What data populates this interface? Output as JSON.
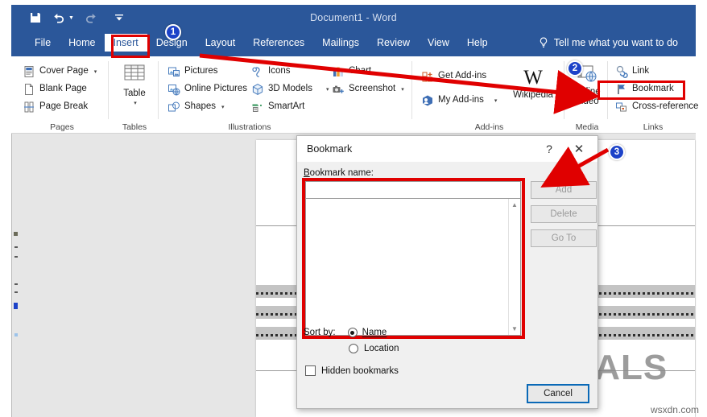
{
  "window": {
    "title": "Document1  -  Word",
    "quick_access": [
      {
        "name": "save-icon",
        "label": "Save"
      },
      {
        "name": "undo-icon",
        "label": "Undo"
      },
      {
        "name": "redo-icon",
        "label": "Redo"
      },
      {
        "name": "customize-quick-access-icon",
        "label": "Customize Quick Access Toolbar"
      }
    ]
  },
  "tabs": [
    {
      "label": "File",
      "active": false
    },
    {
      "label": "Home",
      "active": false
    },
    {
      "label": "Insert",
      "active": true
    },
    {
      "label": "Design",
      "active": false
    },
    {
      "label": "Layout",
      "active": false
    },
    {
      "label": "References",
      "active": false
    },
    {
      "label": "Mailings",
      "active": false
    },
    {
      "label": "Review",
      "active": false
    },
    {
      "label": "View",
      "active": false
    },
    {
      "label": "Help",
      "active": false
    }
  ],
  "tell_me": {
    "label": "Tell me what you want to do",
    "icon": "lightbulb-icon"
  },
  "ribbon": {
    "groups": [
      {
        "name": "Pages",
        "items": [
          {
            "label": "Cover Page",
            "icon": "cover-page-icon",
            "dropdown": true
          },
          {
            "label": "Blank Page",
            "icon": "blank-page-icon",
            "dropdown": false
          },
          {
            "label": "Page Break",
            "icon": "page-break-icon",
            "dropdown": false
          }
        ]
      },
      {
        "name": "Tables",
        "items": [
          {
            "label": "Table",
            "icon": "table-icon",
            "dropdown": true
          }
        ]
      },
      {
        "name": "Illustrations",
        "items": [
          {
            "label": "Pictures",
            "icon": "pictures-icon",
            "dropdown": false
          },
          {
            "label": "Online Pictures",
            "icon": "online-pictures-icon",
            "dropdown": false
          },
          {
            "label": "Shapes",
            "icon": "shapes-icon",
            "dropdown": true
          },
          {
            "label": "Icons",
            "icon": "icons-icon",
            "dropdown": false
          },
          {
            "label": "3D Models",
            "icon": "3d-models-icon",
            "dropdown": true
          },
          {
            "label": "SmartArt",
            "icon": "smartart-icon",
            "dropdown": false
          },
          {
            "label": "Chart",
            "icon": "chart-icon",
            "dropdown": false
          },
          {
            "label": "Screenshot",
            "icon": "screenshot-icon",
            "dropdown": true
          }
        ]
      },
      {
        "name": "Add-ins",
        "items": [
          {
            "label": "Get Add-ins",
            "icon": "get-add-ins-icon",
            "dropdown": false
          },
          {
            "label": "My Add-ins",
            "icon": "my-add-ins-icon",
            "dropdown": true
          },
          {
            "label": "Wikipedia",
            "icon": "wikipedia-icon",
            "dropdown": false
          }
        ]
      },
      {
        "name": "Media",
        "items": [
          {
            "label": "Online Video",
            "icon": "online-video-icon",
            "dropdown": false
          }
        ]
      },
      {
        "name": "Links",
        "items": [
          {
            "label": "Link",
            "icon": "link-icon",
            "dropdown": false
          },
          {
            "label": "Bookmark",
            "icon": "bookmark-icon",
            "dropdown": false
          },
          {
            "label": "Cross-reference",
            "icon": "cross-reference-icon",
            "dropdown": false
          }
        ]
      }
    ]
  },
  "dialog": {
    "title": "Bookmark",
    "help_icon": "?",
    "close_icon": "✕",
    "name_label": "Bookmark name:",
    "name_value": "",
    "list_items": [],
    "buttons": [
      {
        "label": "Add",
        "enabled": false
      },
      {
        "label": "Delete",
        "enabled": false
      },
      {
        "label": "Go To",
        "enabled": false
      }
    ],
    "sort_by_label": "Sort by:",
    "sort_options": [
      {
        "label": "Name",
        "selected": true
      },
      {
        "label": "Location",
        "selected": false
      }
    ],
    "hidden_bookmarks": {
      "label": "Hidden bookmarks",
      "checked": false
    },
    "cancel_label": "Cancel"
  },
  "annotations": {
    "badges": [
      {
        "number": "1",
        "target": "insert-tab"
      },
      {
        "number": "2",
        "target": "online-video"
      },
      {
        "number": "3",
        "target": "add-button"
      }
    ],
    "highlight_color": "#e00000",
    "badge_color": "#1c42c8"
  },
  "watermark": {
    "text": "APPUALS"
  },
  "credit": {
    "text": "wsxdn.com"
  }
}
